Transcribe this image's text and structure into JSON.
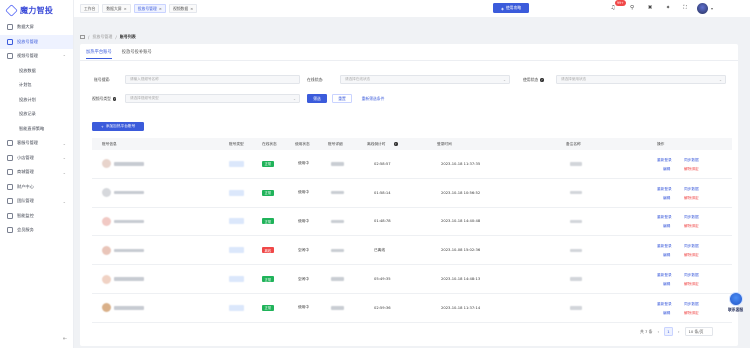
{
  "app": {
    "logo_text": "魔力智投"
  },
  "sidebar": {
    "items": [
      {
        "label": "数据大屏",
        "icon": "monitor-icon"
      },
      {
        "label": "投放号管理",
        "icon": "user-icon",
        "active": true
      },
      {
        "label": "视频号管理",
        "icon": "play-icon",
        "expanded": true
      },
      {
        "label": "投放数据",
        "sub": true
      },
      {
        "label": "计划包",
        "sub": true
      },
      {
        "label": "投放计划",
        "sub": true
      },
      {
        "label": "投放记录",
        "sub": true
      },
      {
        "label": "智能直停策略",
        "sub": true
      },
      {
        "label": "客服号管理",
        "icon": "headset-icon"
      },
      {
        "label": "小店管理",
        "icon": "shop-icon"
      },
      {
        "label": "商城管理",
        "icon": "cart-icon"
      },
      {
        "label": "财户中心",
        "icon": "wallet-icon"
      },
      {
        "label": "团队管理",
        "icon": "team-icon"
      },
      {
        "label": "智能监控",
        "icon": "eye-icon"
      },
      {
        "label": "会员服务",
        "icon": "crown-icon"
      }
    ]
  },
  "header": {
    "tabs": [
      {
        "label": "工作台",
        "closable": false
      },
      {
        "label": "数据大屏",
        "closable": true
      },
      {
        "label": "投放号管理",
        "closable": true,
        "active": true
      },
      {
        "label": "视频数据",
        "closable": true
      }
    ],
    "upgrade_label": "使用攻略",
    "notif_count": "99+"
  },
  "breadcrumb": {
    "parent": "投放号管理",
    "current": "账号列表"
  },
  "subtabs": [
    {
      "label": "加热平台账号",
      "active": true
    },
    {
      "label": "投放号投补账号",
      "active": false
    }
  ],
  "filters": {
    "account_search": {
      "label": "账号搜索:",
      "placeholder": "请输入视频号名称"
    },
    "online_status": {
      "label": "在线状态:",
      "placeholder": "请选择在线状态"
    },
    "usage_status": {
      "label": "使用状态",
      "placeholder": "请选择使用状态"
    },
    "account_type": {
      "label": "视频号类型",
      "placeholder": "请选择视频号类型"
    },
    "query_label": "筛选",
    "reset_label": "重置",
    "clear_label": "重新筛选条件"
  },
  "add_button_label": "添加加热平台账号",
  "table": {
    "columns": [
      "账号信息",
      "账号类型",
      "在线状态",
      "使用状态",
      "账号详细",
      "离线倒计时",
      "登录时间",
      "备注名称",
      "操作"
    ],
    "rows": [
      {
        "status": "正常",
        "status_type": "ok",
        "usage": "使用中",
        "countdown": "02:58:57",
        "login_time": "2023-10-18 11:37:35"
      },
      {
        "status": "正常",
        "status_type": "ok",
        "usage": "使用中",
        "countdown": "01:58:14",
        "login_time": "2023-10-18 10:56:52"
      },
      {
        "status": "正常",
        "status_type": "ok",
        "usage": "使用中",
        "countdown": "01:48:78",
        "login_time": "2023-10-18 14:40:48"
      },
      {
        "status": "离线",
        "status_type": "bad",
        "usage": "空闲中",
        "countdown": "已离线",
        "login_time": "2023-10-08 15:02:36"
      },
      {
        "status": "正常",
        "status_type": "ok",
        "usage": "空闲中",
        "countdown": "05:49:35",
        "login_time": "2023-10-18 14:48:13"
      },
      {
        "status": "正常",
        "status_type": "ok",
        "usage": "使用中",
        "countdown": "02:59:36",
        "login_time": "2023-10-18 11:37:14"
      }
    ],
    "actions": {
      "relogin": "重新登录",
      "sync": "同步数据",
      "edit": "编辑",
      "unbind": "解除绑定"
    }
  },
  "pagination": {
    "total": "共 7 条",
    "current_page": "1",
    "page_size": "10 条/页"
  },
  "helper": {
    "label": "联系客服"
  }
}
